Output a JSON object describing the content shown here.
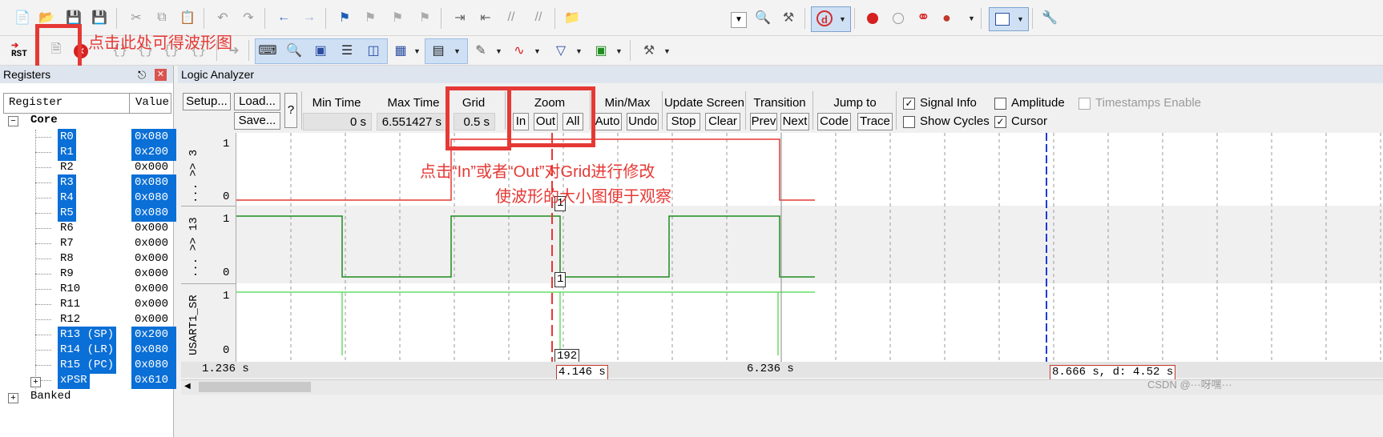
{
  "toolbar_row1": {
    "icons": [
      "new-file-icon",
      "open-folder-icon",
      "save-icon",
      "save-all-icon",
      "cut-icon",
      "copy-icon",
      "paste-icon",
      "undo-icon",
      "redo-icon",
      "back-arrow-icon",
      "forward-arrow-icon",
      "bookmark-icon",
      "prev-bookmark-icon",
      "next-bookmark-icon",
      "clear-bookmark-icon",
      "indent-icon",
      "unindent-icon",
      "comment-icon",
      "uncomment-icon",
      "find-in-files-icon",
      "dropdown-icon",
      "find-icon",
      "debug-tools-icon",
      "debug-session-icon",
      "breakpoint-icon",
      "disabled-breakpoint-icon",
      "kill-breakpoints-icon",
      "breakpoint-settings-icon",
      "window-layout-icon",
      "configure-icon"
    ]
  },
  "toolbar_row2": {
    "rst_label": "RST"
  },
  "annotations": {
    "toolbar_note": "点击此处可得波形图",
    "zoom_note_line1": "点击“In”或者“Out”对Grid进行修改",
    "zoom_note_line2": "使波形的大小图便于观察"
  },
  "registers": {
    "title": "Registers",
    "col_register": "Register",
    "col_value": "Value",
    "group": "Core",
    "rows": [
      {
        "name": "R0",
        "value": "0x080",
        "selected": true
      },
      {
        "name": "R1",
        "value": "0x200",
        "selected": true
      },
      {
        "name": "R2",
        "value": "0x000",
        "selected": false
      },
      {
        "name": "R3",
        "value": "0x080",
        "selected": true
      },
      {
        "name": "R4",
        "value": "0x080",
        "selected": true
      },
      {
        "name": "R5",
        "value": "0x080",
        "selected": true
      },
      {
        "name": "R6",
        "value": "0x000",
        "selected": false
      },
      {
        "name": "R7",
        "value": "0x000",
        "selected": false
      },
      {
        "name": "R8",
        "value": "0x000",
        "selected": false
      },
      {
        "name": "R9",
        "value": "0x000",
        "selected": false
      },
      {
        "name": "R10",
        "value": "0x000",
        "selected": false
      },
      {
        "name": "R11",
        "value": "0x000",
        "selected": false
      },
      {
        "name": "R12",
        "value": "0x000",
        "selected": false
      },
      {
        "name": "R13 (SP)",
        "value": "0x200",
        "selected": true
      },
      {
        "name": "R14 (LR)",
        "value": "0x080",
        "selected": true
      },
      {
        "name": "R15 (PC)",
        "value": "0x080",
        "selected": true
      },
      {
        "name": "xPSR",
        "value": "0x610",
        "selected": true
      }
    ],
    "banked": "Banked"
  },
  "logic_analyzer": {
    "title": "Logic Analyzer",
    "setup_label": "Setup...",
    "load_label": "Load...",
    "save_label": "Save...",
    "help_label": "?",
    "min_time_label": "Min Time",
    "min_time_value": "0 s",
    "max_time_label": "Max Time",
    "max_time_value": "6.551427 s",
    "grid_label": "Grid",
    "grid_value": "0.5 s",
    "zoom_label": "Zoom",
    "zoom_in": "In",
    "zoom_out": "Out",
    "zoom_all": "All",
    "minmax_label": "Min/Max",
    "minmax_auto": "Auto",
    "minmax_undo": "Undo",
    "update_label": "Update Screen",
    "update_stop": "Stop",
    "update_clear": "Clear",
    "transition_label": "Transition",
    "transition_prev": "Prev",
    "transition_next": "Next",
    "jump_label": "Jump to",
    "jump_code": "Code",
    "jump_trace": "Trace",
    "signal_info": {
      "label": "Signal Info",
      "checked": true
    },
    "show_cycles": {
      "label": "Show Cycles",
      "checked": false
    },
    "amplitude": {
      "label": "Amplitude",
      "checked": false
    },
    "cursor": {
      "label": "Cursor",
      "checked": true
    },
    "timestamps": {
      "label": "Timestamps Enable",
      "checked": false,
      "disabled": true
    },
    "signals": [
      {
        "label": "... >> 3",
        "high": "1",
        "low": "0"
      },
      {
        "label": "... >> 13",
        "high": "1",
        "low": "0"
      },
      {
        "label": "USART1_SR",
        "high": "1",
        "low": "0"
      }
    ],
    "value_tags": {
      "sig1": "1",
      "sig2": "1",
      "sig3": "192"
    },
    "time_axis": {
      "left": "1.236 s",
      "cursor": "4.146 s",
      "mid": "6.236 s",
      "right": "8.666 s,  d: 4.52 s"
    },
    "colors": {
      "signal1": "#e53935",
      "signal2": "#1e8c1e",
      "signal3": "#66dd66",
      "cursor": "#e53935",
      "marker": "#1e3ad8"
    }
  },
  "watermark": "CSDN @···呀嘿···"
}
